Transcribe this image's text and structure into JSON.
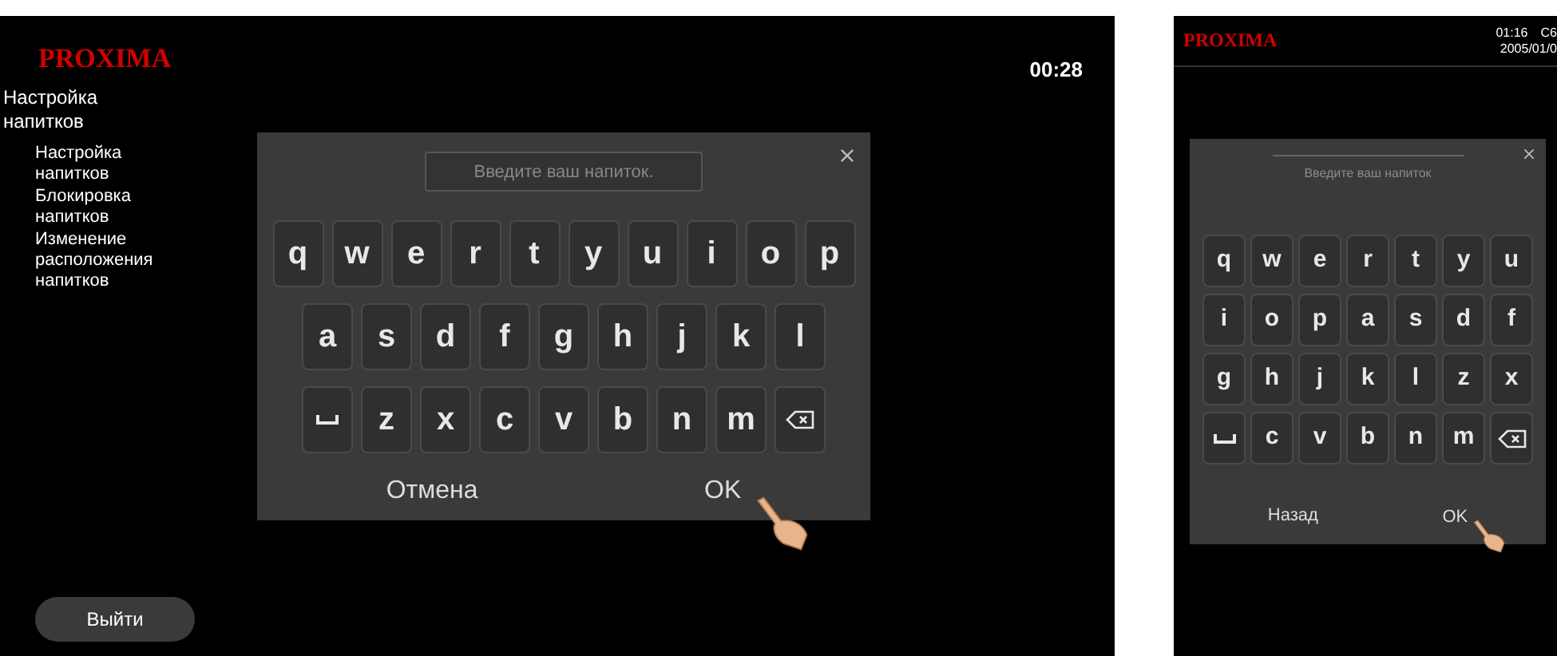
{
  "left_screen": {
    "logo": "PROXIMA",
    "time": "00:28",
    "sidebar": {
      "title": "Настройка напитков",
      "items": [
        {
          "label": "Настройка напитков"
        },
        {
          "label": "Блокировка напитков"
        },
        {
          "label": "Изменение расположения напитков"
        }
      ],
      "exit_button": "Выйти"
    },
    "keyboard": {
      "placeholder": "Введите ваш напиток.",
      "rows": [
        [
          {
            "kind": "char",
            "label": "q"
          },
          {
            "kind": "char",
            "label": "w"
          },
          {
            "kind": "char",
            "label": "e"
          },
          {
            "kind": "char",
            "label": "r"
          },
          {
            "kind": "char",
            "label": "t"
          },
          {
            "kind": "char",
            "label": "y"
          },
          {
            "kind": "char",
            "label": "u"
          },
          {
            "kind": "char",
            "label": "i"
          },
          {
            "kind": "char",
            "label": "o"
          },
          {
            "kind": "char",
            "label": "p"
          }
        ],
        [
          {
            "kind": "char",
            "label": "a"
          },
          {
            "kind": "char",
            "label": "s"
          },
          {
            "kind": "char",
            "label": "d"
          },
          {
            "kind": "char",
            "label": "f"
          },
          {
            "kind": "char",
            "label": "g"
          },
          {
            "kind": "char",
            "label": "h"
          },
          {
            "kind": "char",
            "label": "j"
          },
          {
            "kind": "char",
            "label": "k"
          },
          {
            "kind": "char",
            "label": "l"
          }
        ],
        [
          {
            "kind": "space"
          },
          {
            "kind": "char",
            "label": "z"
          },
          {
            "kind": "char",
            "label": "x"
          },
          {
            "kind": "char",
            "label": "c"
          },
          {
            "kind": "char",
            "label": "v"
          },
          {
            "kind": "char",
            "label": "b"
          },
          {
            "kind": "char",
            "label": "n"
          },
          {
            "kind": "char",
            "label": "m"
          },
          {
            "kind": "backspace"
          }
        ]
      ],
      "cancel_button": "Отмена",
      "ok_button": "OK"
    }
  },
  "right_screen": {
    "logo": "PROXIMA",
    "time": "01:16",
    "code": "C6",
    "date": "2005/01/0",
    "keyboard": {
      "placeholder": "Введите ваш напиток",
      "rows": [
        [
          {
            "kind": "char",
            "label": "q"
          },
          {
            "kind": "char",
            "label": "w"
          },
          {
            "kind": "char",
            "label": "e"
          },
          {
            "kind": "char",
            "label": "r"
          },
          {
            "kind": "char",
            "label": "t"
          },
          {
            "kind": "char",
            "label": "y"
          },
          {
            "kind": "char",
            "label": "u"
          }
        ],
        [
          {
            "kind": "char",
            "label": "i"
          },
          {
            "kind": "char",
            "label": "o"
          },
          {
            "kind": "char",
            "label": "p"
          },
          {
            "kind": "char",
            "label": "a"
          },
          {
            "kind": "char",
            "label": "s"
          },
          {
            "kind": "char",
            "label": "d"
          },
          {
            "kind": "char",
            "label": "f"
          }
        ],
        [
          {
            "kind": "char",
            "label": "g"
          },
          {
            "kind": "char",
            "label": "h"
          },
          {
            "kind": "char",
            "label": "j"
          },
          {
            "kind": "char",
            "label": "k"
          },
          {
            "kind": "char",
            "label": "l"
          },
          {
            "kind": "char",
            "label": "z"
          },
          {
            "kind": "char",
            "label": "x"
          }
        ],
        [
          {
            "kind": "space"
          },
          {
            "kind": "char",
            "label": "c"
          },
          {
            "kind": "char",
            "label": "v"
          },
          {
            "kind": "char",
            "label": "b"
          },
          {
            "kind": "char",
            "label": "n"
          },
          {
            "kind": "char",
            "label": "m"
          },
          {
            "kind": "backspace"
          }
        ]
      ],
      "cancel_button": "Назад",
      "ok_button": "OK"
    }
  }
}
